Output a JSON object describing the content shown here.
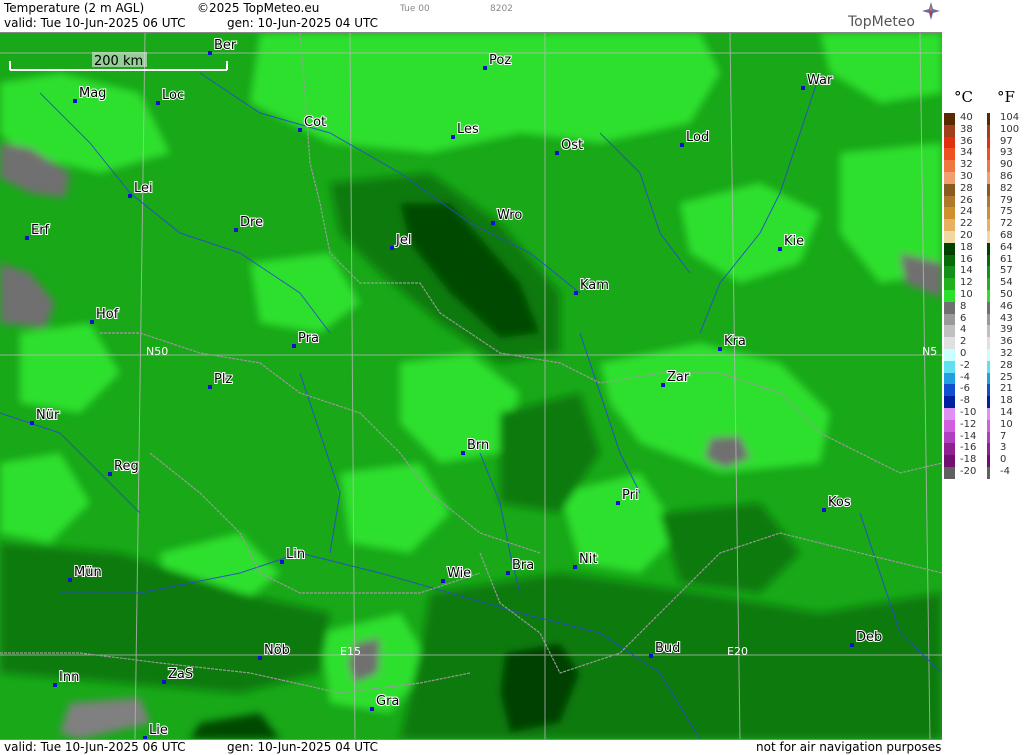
{
  "header": {
    "title": "Temperature (2 m AGL)",
    "copyright": "©2025 TopMeteo.eu",
    "tab_time": "Tue 00",
    "code": "8202",
    "valid_text": "valid:  Tue  10-Jun-2025  06 UTC",
    "gen_text": "gen:  10-Jun-2025 04 UTC",
    "logo_text": "TopMeteo"
  },
  "footer": {
    "valid_text": "valid:  Tue  10-Jun-2025  06 UTC",
    "gen_text": "gen:  10-Jun-2025 04 UTC",
    "disclaimer": "not for air navigation purposes"
  },
  "scale_bar": {
    "label": "200 km"
  },
  "grid_labels": {
    "n50_left": "N50",
    "n50_right": "N5",
    "e15": "E15",
    "e20": "E20"
  },
  "cities": [
    {
      "name": "Ber"
    },
    {
      "name": "Poz"
    },
    {
      "name": "War"
    },
    {
      "name": "Mag"
    },
    {
      "name": "Loc"
    },
    {
      "name": "Cot"
    },
    {
      "name": "Les"
    },
    {
      "name": "Ost"
    },
    {
      "name": "Lod"
    },
    {
      "name": "Lei"
    },
    {
      "name": "Erf"
    },
    {
      "name": "Dre"
    },
    {
      "name": "Jel"
    },
    {
      "name": "Wro"
    },
    {
      "name": "Kie"
    },
    {
      "name": "Kam"
    },
    {
      "name": "Hof"
    },
    {
      "name": "Pra"
    },
    {
      "name": "Kra"
    },
    {
      "name": "Zar"
    },
    {
      "name": "Plz"
    },
    {
      "name": "Nür"
    },
    {
      "name": "Reg"
    },
    {
      "name": "Brn"
    },
    {
      "name": "Pri"
    },
    {
      "name": "Kos"
    },
    {
      "name": "Lin"
    },
    {
      "name": "Nit"
    },
    {
      "name": "Bra"
    },
    {
      "name": "Wie"
    },
    {
      "name": "Mün"
    },
    {
      "name": "Bud"
    },
    {
      "name": "Deb"
    },
    {
      "name": "Nõb"
    },
    {
      "name": "Inn"
    },
    {
      "name": "ZaS"
    },
    {
      "name": "Gra"
    },
    {
      "name": "Lie"
    }
  ],
  "legend": {
    "celsius_unit": "°C",
    "fahrenheit_unit": "°F",
    "celsius": [
      "40",
      "38",
      "36",
      "34",
      "32",
      "30",
      "28",
      "26",
      "24",
      "22",
      "20",
      "18",
      "16",
      "14",
      "12",
      "10",
      "8",
      "6",
      "4",
      "2",
      "0",
      "-2",
      "-4",
      "-6",
      "-8",
      "-10",
      "-12",
      "-14",
      "-16",
      "-18",
      "-20"
    ],
    "fahrenheit": [
      "104",
      "100",
      "97",
      "93",
      "90",
      "86",
      "82",
      "79",
      "75",
      "72",
      "68",
      "64",
      "61",
      "57",
      "54",
      "50",
      "46",
      "43",
      "39",
      "36",
      "32",
      "28",
      "25",
      "21",
      "18",
      "14",
      "10",
      "7",
      "3",
      "0",
      "-4"
    ],
    "colors": [
      "#5a2a00",
      "#a0401a",
      "#e03010",
      "#f05020",
      "#f07840",
      "#f0a070",
      "#8a5a20",
      "#b0782a",
      "#d09030",
      "#e8b060",
      "#f0d8a0",
      "#004000",
      "#0a6a0a",
      "#14901a",
      "#20b020",
      "#2ee02e",
      "#707070",
      "#9a9a9a",
      "#c0c0c0",
      "#e0e0e0",
      "#c8ffff",
      "#60e0f0",
      "#20a0e0",
      "#1050d0",
      "#0020a0",
      "#e090f0",
      "#d060e0",
      "#b040c0",
      "#902090",
      "#701070",
      "#606060"
    ]
  }
}
